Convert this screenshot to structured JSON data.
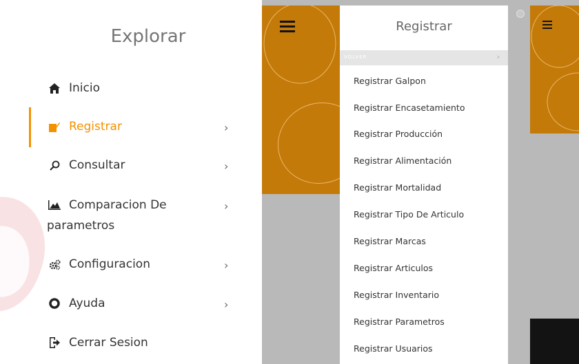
{
  "menu": {
    "title": "Explorar",
    "items": [
      {
        "label": "Inicio",
        "icon": "home-icon",
        "active": false,
        "has_submenu": false
      },
      {
        "label": "Registrar",
        "icon": "edit-icon",
        "active": true,
        "has_submenu": true
      },
      {
        "label": "Consultar",
        "icon": "search-icon",
        "active": false,
        "has_submenu": true
      },
      {
        "label": "Comparacion De",
        "label_line2": "parametros",
        "icon": "area-chart-icon",
        "active": false,
        "has_submenu": true
      },
      {
        "label": "Configuracion",
        "icon": "cogs-icon",
        "active": false,
        "has_submenu": true
      },
      {
        "label": "Ayuda",
        "icon": "lifebuoy-icon",
        "active": false,
        "has_submenu": true
      },
      {
        "label": "Cerrar Sesion",
        "icon": "sign-out-icon",
        "active": false,
        "has_submenu": false
      }
    ]
  },
  "submenu": {
    "title": "Registrar",
    "back_label": "VOLVER",
    "items": [
      "Registrar Galpon",
      "Registrar Encasetamiento",
      "Registrar Producción",
      "Registrar Alimentación",
      "Registrar Mortalidad",
      "Registrar Tipo De Articulo",
      "Registrar Marcas",
      "Registrar Articulos",
      "Registrar Inventario",
      "Registrar Parametros",
      "Registrar Usuarios"
    ]
  },
  "colors": {
    "accent": "#f39200",
    "header": "#c47a09",
    "overlay": "#b9b9b9",
    "dark_footer": "#131313"
  }
}
